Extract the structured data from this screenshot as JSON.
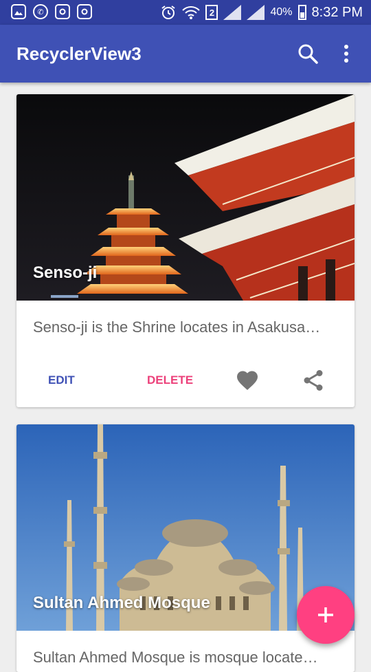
{
  "status_bar": {
    "sim": "2",
    "battery": "40%",
    "time": "8:32 PM",
    "icons": [
      "gallery-icon",
      "whatsapp-icon",
      "instagram-icon",
      "instagram-icon",
      "alarm-icon",
      "wifi-icon",
      "signal-icon",
      "battery-icon"
    ]
  },
  "app_bar": {
    "title": "RecyclerView3",
    "icons": [
      "search-icon",
      "more-vert-icon"
    ]
  },
  "cards": [
    {
      "title": "Senso-ji",
      "description": "Senso-ji is the Shrine locates in Asakusa…",
      "edit_label": "EDIT",
      "delete_label": "DELETE"
    },
    {
      "title": "Sultan Ahmed Mosque",
      "description": "Sultan Ahmed Mosque is mosque locate…"
    }
  ],
  "fab": {
    "icon": "add-icon"
  },
  "colors": {
    "primary": "#3f51b5",
    "primary_dark": "#303f9f",
    "accent": "#ff4081",
    "edit": "#3f51b5",
    "delete": "#ec407a"
  }
}
